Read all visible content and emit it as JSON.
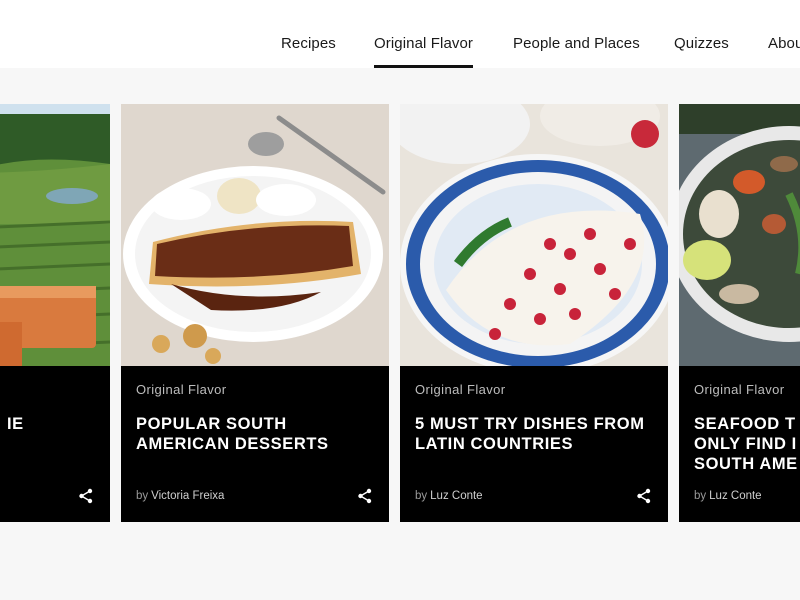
{
  "nav": {
    "items": [
      {
        "label": "Recipes",
        "active": false
      },
      {
        "label": "Original Flavor",
        "active": true
      },
      {
        "label": "People and Places",
        "active": false
      },
      {
        "label": "Quizzes",
        "active": false
      },
      {
        "label": "Abou",
        "active": false
      }
    ]
  },
  "cards": [
    {
      "category": "",
      "title_lines": [
        "IE",
        ""
      ],
      "author_prefix": "",
      "author": "",
      "image": "vineyard-landscape-with-cheese"
    },
    {
      "category": "Original Flavor",
      "title_lines": [
        "POPULAR SOUTH",
        "AMERICAN DESSERTS"
      ],
      "author_prefix": "by",
      "author": "Victoria Freixa",
      "image": "crepes-with-chocolate-sauce"
    },
    {
      "category": "Original Flavor",
      "title_lines": [
        "5 MUST TRY DISHES FROM",
        "LATIN COUNTRIES"
      ],
      "author_prefix": "by",
      "author": "Luz Conte",
      "image": "chiles-en-nogada-with-pomegranate"
    },
    {
      "category": "Original Flavor",
      "title_lines": [
        "SEAFOOD T",
        "ONLY FIND I",
        "SOUTH AME"
      ],
      "author_prefix": "by",
      "author": "Luz Conte",
      "image": "seafood-bowl-with-clams"
    }
  ],
  "icons": {
    "share": "share-icon"
  },
  "colors": {
    "card_bg": "#000000",
    "nav_underline": "#111111",
    "page_bg": "#f7f7f7"
  }
}
